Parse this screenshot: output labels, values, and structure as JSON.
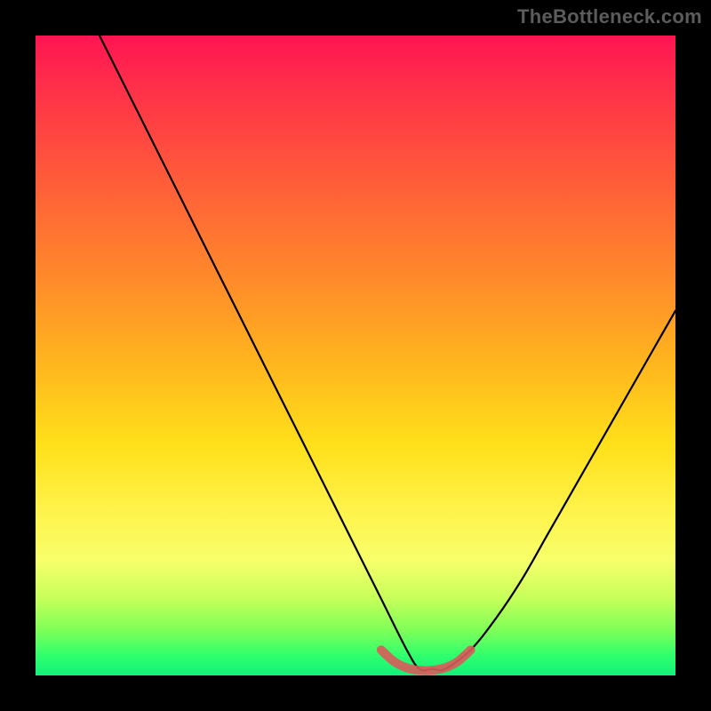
{
  "watermark": "TheBottleneck.com",
  "gradient_colors": {
    "top": "#ff1452",
    "mid_upper": "#ff8a2a",
    "mid": "#ffe01a",
    "mid_lower": "#f7ff6a",
    "bottom": "#12f07a"
  },
  "chart_data": {
    "type": "line",
    "title": "",
    "xlabel": "",
    "ylabel": "",
    "xlim": [
      0,
      100
    ],
    "ylim": [
      0,
      100
    ],
    "series": [
      {
        "name": "main-curve",
        "color": "#000000",
        "x": [
          10,
          14,
          18,
          22,
          26,
          30,
          34,
          38,
          42,
          46,
          50,
          54,
          58,
          60,
          62,
          64,
          68,
          72,
          76,
          80,
          84,
          88,
          92,
          96,
          100
        ],
        "values": [
          100,
          92,
          84,
          76,
          68,
          60,
          52,
          44,
          36,
          28,
          20,
          12,
          4,
          1,
          1,
          1,
          4,
          9,
          15,
          22,
          29,
          36,
          43,
          50,
          57
        ]
      },
      {
        "name": "highlight-band",
        "color": "#d95b5b",
        "x": [
          54,
          56,
          58,
          60,
          62,
          64,
          66,
          68
        ],
        "values": [
          4,
          2.2,
          1.2,
          0.8,
          0.8,
          1.2,
          2.2,
          4
        ]
      }
    ]
  }
}
